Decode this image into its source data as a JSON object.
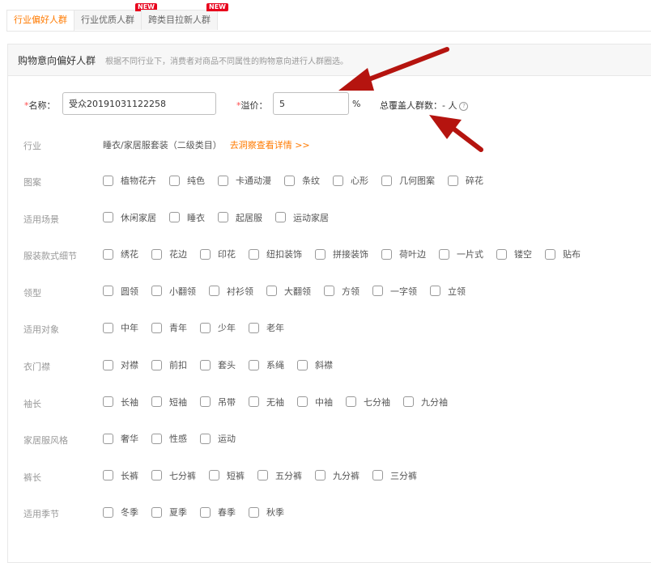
{
  "tabs": [
    {
      "label": "行业偏好人群",
      "active": true,
      "badge": ""
    },
    {
      "label": "行业优质人群",
      "active": false,
      "badge": "NEW"
    },
    {
      "label": "跨类目拉新人群",
      "active": false,
      "badge": "NEW"
    }
  ],
  "panel": {
    "title": "购物意向偏好人群",
    "description": "根据不同行业下，消费者对商品不同属性的购物意向进行人群圈选。"
  },
  "form": {
    "name_label": "名称：",
    "name_value": "受众20191031122258",
    "premium_label": "溢价：",
    "premium_value": "5",
    "premium_unit": "%",
    "coverage_label": "总覆盖人群数：",
    "coverage_value": "- 人",
    "help_icon": "question-circle-icon",
    "required_mark": "*"
  },
  "industry": {
    "label": "行业",
    "value": "睡衣/家居服套装（二级类目）",
    "link": "去洞察查看详情 >>"
  },
  "attributes": [
    {
      "label": "图案",
      "options": [
        "植物花卉",
        "纯色",
        "卡通动漫",
        "条纹",
        "心形",
        "几何图案",
        "碎花"
      ]
    },
    {
      "label": "适用场景",
      "options": [
        "休闲家居",
        "睡衣",
        "起居服",
        "运动家居"
      ]
    },
    {
      "label": "服装款式细节",
      "options": [
        "绣花",
        "花边",
        "印花",
        "纽扣装饰",
        "拼接装饰",
        "荷叶边",
        "一片式",
        "镂空",
        "贴布"
      ]
    },
    {
      "label": "领型",
      "options": [
        "圆领",
        "小翻领",
        "衬衫领",
        "大翻领",
        "方领",
        "一字领",
        "立领"
      ]
    },
    {
      "label": "适用对象",
      "options": [
        "中年",
        "青年",
        "少年",
        "老年"
      ]
    },
    {
      "label": "衣门襟",
      "options": [
        "对襟",
        "前扣",
        "套头",
        "系绳",
        "斜襟"
      ]
    },
    {
      "label": "袖长",
      "options": [
        "长袖",
        "短袖",
        "吊带",
        "无袖",
        "中袖",
        "七分袖",
        "九分袖"
      ]
    },
    {
      "label": "家居服风格",
      "options": [
        "奢华",
        "性感",
        "运动"
      ]
    },
    {
      "label": "裤长",
      "options": [
        "长裤",
        "七分裤",
        "短裤",
        "五分裤",
        "九分裤",
        "三分裤"
      ]
    },
    {
      "label": "适用季节",
      "options": [
        "冬季",
        "夏季",
        "春季",
        "秋季"
      ]
    }
  ],
  "colors": {
    "accent": "#ff7a00",
    "badge": "#e8001c",
    "arrow": "#b5140f",
    "required": "#ff4d4f"
  }
}
